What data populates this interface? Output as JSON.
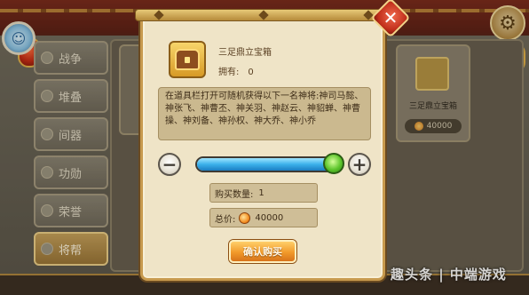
{
  "sidebar": {
    "tabs": [
      {
        "label": "战争",
        "active": false
      },
      {
        "label": "堆叠",
        "active": false
      },
      {
        "label": "间器",
        "active": false
      },
      {
        "label": "功勋",
        "active": false
      },
      {
        "label": "荣誉",
        "active": false
      },
      {
        "label": "将帮",
        "active": true
      }
    ]
  },
  "background_cards": [
    {
      "name": "",
      "price": ""
    },
    {
      "name": "三足鼎立宝箱",
      "price": "40000"
    }
  ],
  "dialog": {
    "close_label": "✕",
    "item": {
      "name": "三足鼎立宝箱",
      "owned_label": "拥有:",
      "owned_value": "0"
    },
    "description": "在道具栏打开可随机获得以下一名神将:神司马懿、神张飞、神曹丕、神关羽、神赵云、神貂蝉、神曹操、神刘备、神孙权、神大乔、神小乔",
    "slider": {
      "minus_label": "−",
      "plus_label": "+",
      "level": 1.0
    },
    "quantity": {
      "label": "购买数量:",
      "value": "1"
    },
    "total": {
      "label": "总价:",
      "value": "40000"
    },
    "buy_label": "确认购买"
  },
  "watermark": "趣头条 | 中端游戏",
  "colors": {
    "dialog_bg": "#efe4c7",
    "dialog_border": "#c79a4e",
    "buy_button": "#f19a2a",
    "slider_fill": "#3bb0ea",
    "slider_knob": "#5dc52c",
    "close_button": "#c2301c"
  }
}
